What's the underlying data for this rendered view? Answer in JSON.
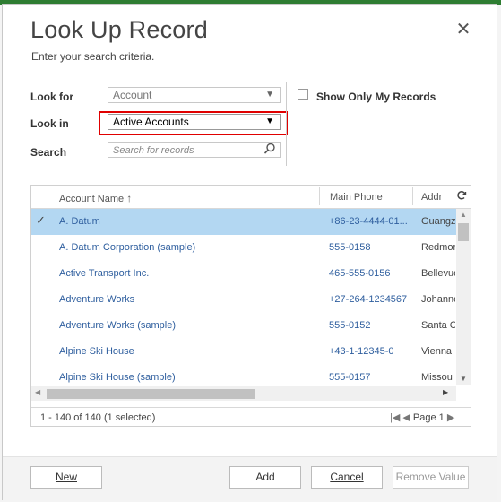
{
  "dialog": {
    "title": "Look Up Record",
    "subtitle": "Enter your search criteria."
  },
  "form": {
    "look_for_label": "Look for",
    "look_for_value": "Account",
    "look_in_label": "Look in",
    "look_in_value": "Active Accounts",
    "search_label": "Search",
    "search_placeholder": "Search for records",
    "show_only_mine_label": "Show Only My Records",
    "show_only_mine_checked": false
  },
  "grid": {
    "columns": [
      "Account Name",
      "Main Phone",
      "Addr"
    ],
    "sort_column": "Account Name",
    "sort_direction": "ascending",
    "rows": [
      {
        "name": "A. Datum",
        "phone": "+86-23-4444-01...",
        "addr": "Guangz",
        "selected": true
      },
      {
        "name": "A. Datum Corporation (sample)",
        "phone": "555-0158",
        "addr": "Redmor",
        "selected": false
      },
      {
        "name": "Active Transport Inc.",
        "phone": "465-555-0156",
        "addr": "Bellevue",
        "selected": false
      },
      {
        "name": "Adventure Works",
        "phone": "+27-264-1234567",
        "addr": "Johanne",
        "selected": false
      },
      {
        "name": "Adventure Works (sample)",
        "phone": "555-0152",
        "addr": "Santa C",
        "selected": false
      },
      {
        "name": "Alpine Ski House",
        "phone": "+43-1-12345-0",
        "addr": "Vienna",
        "selected": false
      },
      {
        "name": "Alpine Ski House (sample)",
        "phone": "555-0157",
        "addr": "Missou",
        "selected": false
      }
    ],
    "status": "1 - 140 of 140 (1 selected)",
    "page_label": "Page 1"
  },
  "buttons": {
    "new": "New",
    "add": "Add",
    "cancel": "Cancel",
    "remove": "Remove Value"
  },
  "colors": {
    "selection": "#b3d7f2",
    "link": "#2e5e9e",
    "highlight_border": "#e00000"
  }
}
